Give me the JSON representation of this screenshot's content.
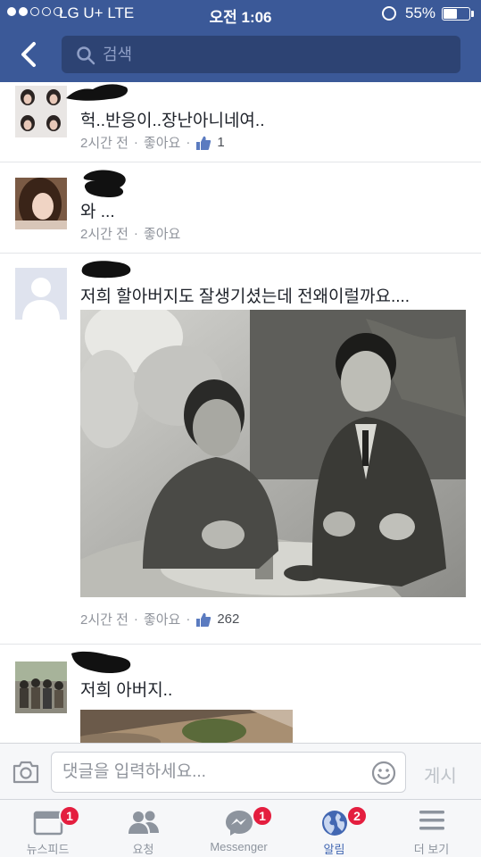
{
  "status_bar": {
    "carrier": "LG U+  LTE",
    "time": "오전 1:06",
    "battery": "55%",
    "battery_level": 0.55
  },
  "header": {
    "search_placeholder": "검색",
    "back_icon": "chevron-left-icon",
    "search_icon": "magnifier-icon"
  },
  "comments": [
    {
      "text": "헉..반응이..장난아니네여..",
      "time": "2시간 전",
      "like_label": "좋아요",
      "likes": "1"
    },
    {
      "text": "와 ...",
      "time": "2시간 전",
      "like_label": "좋아요",
      "likes": ""
    },
    {
      "text": "저희 할아버지도 잘생기셨는데 전왜이럴까요....",
      "time": "2시간 전",
      "like_label": "좋아요",
      "likes": "262"
    },
    {
      "text": "저희 아버지..",
      "time": "",
      "like_label": "",
      "likes": ""
    }
  ],
  "composer": {
    "placeholder": "댓글을 입력하세요...",
    "post_label": "게시",
    "camera_icon": "camera-icon",
    "sticker_icon": "smiley-icon"
  },
  "tabs": [
    {
      "label": "뉴스피드",
      "badge": "1",
      "icon": "newsfeed-icon"
    },
    {
      "label": "요청",
      "badge": "",
      "icon": "friends-icon"
    },
    {
      "label": "Messenger",
      "badge": "1",
      "icon": "messenger-icon"
    },
    {
      "label": "알림",
      "badge": "2",
      "icon": "globe-icon",
      "active": true
    },
    {
      "label": "더 보기",
      "badge": "",
      "icon": "menu-icon"
    }
  ],
  "colors": {
    "brand": "#3b5998",
    "badge": "#e41e3f",
    "active_tab": "#4267b2"
  }
}
